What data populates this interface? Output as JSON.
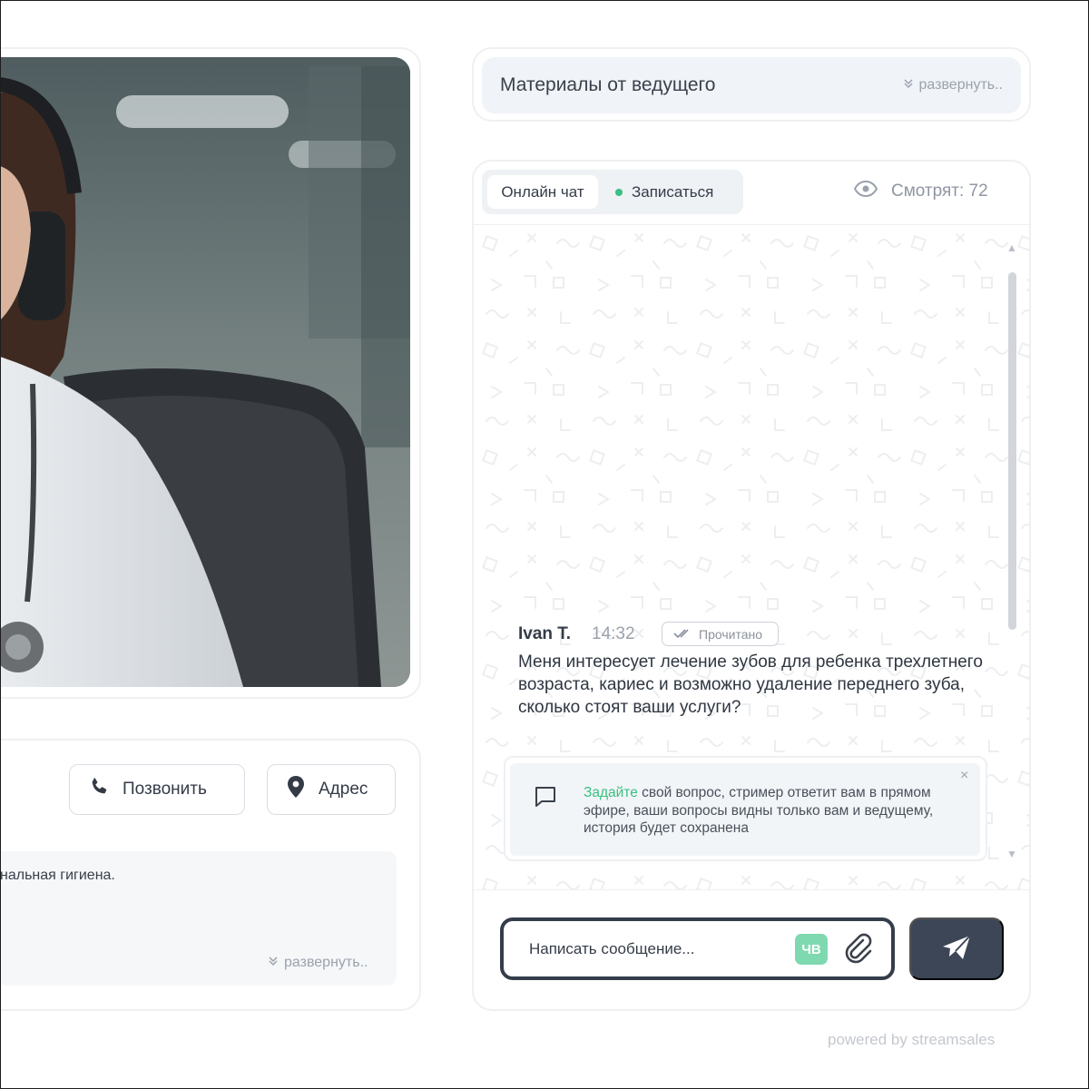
{
  "left": {
    "call_label": "Позвонить",
    "address_label": "Адрес",
    "description_fragment": "нальная гигиена.",
    "expand_label": "развернуть.."
  },
  "materials": {
    "title": "Материалы от ведущего",
    "expand_label": "развернуть.."
  },
  "chat": {
    "tabs": [
      {
        "label": "Онлайн чат",
        "active": true
      },
      {
        "label": "Записаться",
        "active": false
      }
    ],
    "viewers_label": "Смотрят: 72",
    "message": {
      "author": "Ivan T.",
      "time": "14:32",
      "status": "Прочитано",
      "text": "Меня интересует лечение зубов для ребенка трехлетнего возраста, кариес и возможно удаление переднего зуба, сколько стоят ваши услуги?"
    },
    "hint": {
      "accent": "Задайте",
      "text": " свой вопрос, стример ответит вам в прямом эфире, ваши вопросы видны только вам и ведущему, история будет сохранена"
    },
    "input": {
      "placeholder": "Написать сообщение...",
      "value": ""
    },
    "keyboard_badge": "ЧВ"
  },
  "footer": {
    "powered_by": "powered by streamsales"
  },
  "icons": {
    "call": "phone-icon",
    "address": "map-pin-icon",
    "expand": "chevrons-down-icon",
    "viewers": "eye-icon",
    "read": "double-check-icon",
    "hint": "chat-bubble-icon",
    "close": "close-icon",
    "attach": "paperclip-icon",
    "send": "send-icon"
  },
  "colors": {
    "accent_green": "#3bbf82",
    "dark": "#353d4b",
    "send_button": "#3d4656"
  }
}
